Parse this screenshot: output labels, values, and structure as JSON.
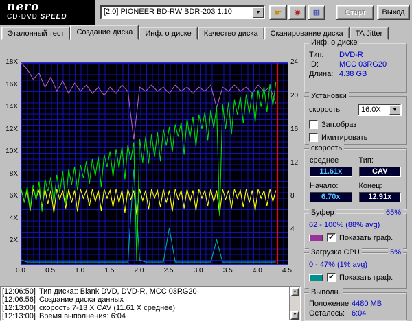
{
  "header": {
    "logo": {
      "line1": "nero",
      "line2": "CD·DVD",
      "line3": "SPEED"
    },
    "drive_selector": {
      "value": "[2:0]  PIONEER BD-RW  BDR-203 1.10"
    },
    "buttons": {
      "start": "Старт",
      "exit": "Выход"
    }
  },
  "tabs": [
    {
      "label": "Эталонный тест",
      "active": false
    },
    {
      "label": "Создание диска",
      "active": true
    },
    {
      "label": "Инф. о диске",
      "active": false
    },
    {
      "label": "Качество диска",
      "active": false
    },
    {
      "label": "Сканирование диска",
      "active": false
    },
    {
      "label": "TA Jitter",
      "active": false
    }
  ],
  "chart_data": {
    "type": "line",
    "x_axis": {
      "min": 0,
      "max": 4.5,
      "tick_labels": [
        "0.0",
        "0.5",
        "1.0",
        "1.5",
        "2.0",
        "2.5",
        "3.0",
        "3.5",
        "4.0",
        "4.5"
      ],
      "tick_values": [
        0,
        0.5,
        1,
        1.5,
        2,
        2.5,
        3,
        3.5,
        4,
        4.5
      ]
    },
    "y_left": {
      "min": 0,
      "max": 18,
      "unit": "X",
      "tick_labels": [
        "18X",
        "16X",
        "14X",
        "12X",
        "10X",
        "8X",
        "6X",
        "4X",
        "2X"
      ],
      "tick_values": [
        18,
        16,
        14,
        12,
        10,
        8,
        6,
        4,
        2
      ]
    },
    "y_right": {
      "min": 0,
      "max": 24,
      "tick_labels": [
        "24",
        "20",
        "16",
        "12",
        "8",
        "4"
      ],
      "tick_values": [
        24,
        20,
        16,
        12,
        8,
        4
      ]
    },
    "grid": {
      "color": "#1212b0",
      "bg": "#000006"
    },
    "legend_position": "none",
    "series": [
      {
        "name": "buffer-level",
        "color": "#b05fb5",
        "unit": "percent",
        "x_start": 0,
        "x_step": 0.1,
        "values": [
          100,
          97,
          92,
          95,
          88,
          93,
          86,
          91,
          85,
          90,
          86,
          89,
          85,
          88,
          84,
          88,
          85,
          89,
          86,
          62,
          88,
          86,
          89,
          86,
          88,
          85,
          89,
          86,
          88,
          85,
          88,
          86,
          89,
          78,
          88,
          86,
          89,
          86,
          88,
          85,
          89,
          86,
          88,
          80
        ]
      },
      {
        "name": "cpu-usage",
        "color": "#00a8a8",
        "unit": "percent",
        "x_start": 0,
        "x_step": 0.1,
        "values": [
          2,
          1,
          1,
          1,
          1,
          1,
          1,
          1,
          1,
          1,
          1,
          1,
          1,
          1,
          1,
          1,
          1,
          1,
          1,
          47,
          2,
          1,
          1,
          1,
          1,
          18,
          1,
          1,
          1,
          1,
          1,
          1,
          1,
          12,
          1,
          1,
          1,
          1,
          1,
          1,
          1,
          1,
          1,
          1
        ]
      },
      {
        "name": "secondary-speed",
        "color": "#ffff00",
        "unit": "speed_x",
        "x_start": 0,
        "x_step": 0.05,
        "values": [
          6.6,
          5.6,
          6.6,
          4.8,
          6.7,
          5.9,
          6.6,
          5.1,
          6.7,
          5.4,
          6.6,
          4.6,
          6.7,
          5.8,
          6.6,
          5.0,
          6.7,
          5.5,
          6.6,
          4.7,
          6.7,
          5.9,
          6.6,
          5.2,
          6.7,
          5.6,
          6.6,
          4.8,
          6.7,
          5.9,
          6.6,
          5.1,
          6.7,
          5.5,
          6.6,
          4.6,
          6.7,
          5.8,
          6.6,
          4.4,
          6.7,
          5.7,
          6.6,
          4.9,
          6.7,
          5.9,
          6.6,
          5.1,
          6.7,
          5.5,
          6.6,
          4.7,
          6.7,
          5.8,
          6.6,
          5.0,
          6.7,
          5.6,
          6.6,
          4.8,
          6.7,
          5.9,
          6.6,
          5.2,
          6.7,
          5.6,
          6.6,
          4.5,
          6.7,
          5.8,
          6.6,
          5.0,
          6.7,
          5.9,
          6.6,
          5.1,
          6.7,
          5.5,
          6.6,
          4.8,
          6.7,
          5.9,
          6.6,
          5.2,
          6.7,
          5.6,
          6.6
        ]
      },
      {
        "name": "write-speed",
        "color": "#00dd00",
        "unit": "speed_x",
        "x_start": 0,
        "x_step": 0.05,
        "values": [
          6.7,
          5.5,
          6.9,
          4.9,
          7.1,
          5.7,
          7.4,
          4.7,
          7.6,
          6.5,
          7.8,
          5.5,
          8.0,
          6.4,
          8.3,
          5.4,
          8.5,
          7.1,
          8.7,
          6.6,
          8.9,
          7.7,
          9.2,
          7.2,
          9.4,
          7.9,
          9.6,
          6.9,
          9.8,
          8.7,
          10.1,
          7.8,
          10.3,
          8.6,
          10.5,
          7.6,
          10.7,
          9.3,
          10.9,
          0.3,
          11.2,
          9.1,
          11.4,
          9.0,
          11.6,
          9.6,
          11.8,
          9.2,
          12.1,
          10.6,
          12.3,
          10.0,
          12.5,
          11.4,
          12.7,
          9.8,
          13.0,
          11.3,
          13.2,
          10.5,
          13.4,
          12.1,
          13.6,
          11.1,
          13.8,
          12.2,
          14.1,
          4.3,
          14.3,
          12.1,
          14.5,
          11.6,
          14.7,
          13.4,
          15.0,
          12.6,
          15.2,
          13.5,
          15.4,
          12.7,
          15.6,
          14.1,
          15.9,
          13.6,
          16.1,
          14.2,
          16.3
        ]
      }
    ],
    "end_marker": {
      "x": 4.33,
      "color": "#ff0000"
    }
  },
  "side_panel": {
    "disc_info": {
      "title": "Инф. о диске",
      "rows": [
        {
          "label": "Тип:",
          "value": "DVD-R"
        },
        {
          "label": "ID:",
          "value": "MCC 03RG20"
        },
        {
          "label": "Длина:",
          "value": "4.38 GB"
        }
      ]
    },
    "settings": {
      "title": "Установки",
      "speed_label": "скорость",
      "speed_value": "16.0X",
      "write_image": {
        "label": "Зап.образ",
        "checked": false
      },
      "simulate": {
        "label": "Имитировать",
        "checked": false
      }
    },
    "speed": {
      "title": "скорость",
      "avg_label": "среднее",
      "type_label": "Тип:",
      "avg_value": "11.61x",
      "type_value": "CAV",
      "start_label": "Начало:",
      "end_label": "Конец:",
      "start_value": "6.70x",
      "end_value": "12.91x"
    },
    "buffer": {
      "title": "Буфер",
      "current": "65%",
      "range": "62 - 100% (88% avg)",
      "show_graph": {
        "label": "Показать граф.",
        "checked": true
      },
      "color": "#993399"
    },
    "cpu": {
      "title": "Загрузка CPU",
      "current": "5%",
      "range": "0 - 47% (1% avg)",
      "show_graph": {
        "label": "Показать граф.",
        "checked": true
      },
      "color": "#009090"
    },
    "progress": {
      "title": "Выполн.",
      "position_label": "Положение",
      "position_value": "4480 МВ",
      "remaining_label": "Осталось:",
      "remaining_value": "6:04"
    }
  },
  "log": {
    "lines": [
      {
        "time": "[12:06:50]",
        "text": "Тип диска:: Blank DVD, DVD-R, MCC 03RG20"
      },
      {
        "time": "[12:06:56]",
        "text": "Создание диска данных"
      },
      {
        "time": "[12:13:00]",
        "text": "скорость:7-13 X CAV (11.61 X среднее)"
      },
      {
        "time": "[12:13:00]",
        "text": "Время выполнения: 6:04"
      }
    ]
  },
  "colors": {
    "window_bg": "#c0c0c0",
    "value_text": "#0000cc",
    "avg_text": "#58c6ff",
    "type_text": "#ffffff",
    "start_text": "#58c6ff",
    "end_text": "#ffffff",
    "plot_bg": "#000006",
    "grid": "#1212b0"
  }
}
